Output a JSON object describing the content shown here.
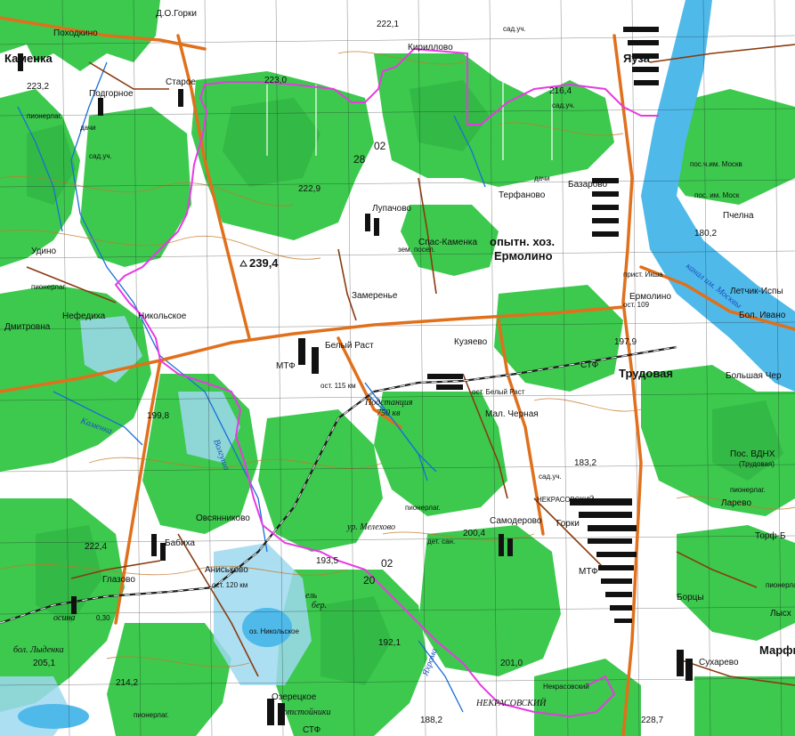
{
  "settlements": [
    {
      "id": "pokhodkino",
      "text": "Походкино"
    },
    {
      "id": "gorki_do",
      "text": "Д.О.Горки"
    },
    {
      "id": "kamenka",
      "text": "Каменка"
    },
    {
      "id": "podgornoe",
      "text": "Подгорное"
    },
    {
      "id": "starovo",
      "text": "Старое"
    },
    {
      "id": "tsirilovo",
      "text": "Кириллово"
    },
    {
      "id": "yauza",
      "text": "Яуза"
    },
    {
      "id": "lupachovo",
      "text": "Лупачово"
    },
    {
      "id": "terfanovo",
      "text": "Терфаново"
    },
    {
      "id": "bazarovo",
      "text": "Базарово"
    },
    {
      "id": "spas_kamenka",
      "text": "Спас-Каменка"
    },
    {
      "id": "opytn_khoz",
      "text": "опытн. хоз."
    },
    {
      "id": "ermolino",
      "text": "Ермолино"
    },
    {
      "id": "ermolino2",
      "text": "Ермолино"
    },
    {
      "id": "udino",
      "text": "Удино"
    },
    {
      "id": "zamerenye",
      "text": "Замеренье"
    },
    {
      "id": "nefediha",
      "text": "Нефедиха"
    },
    {
      "id": "nikolskoe",
      "text": "Никольское"
    },
    {
      "id": "dmitrovna",
      "text": "Дмитровна"
    },
    {
      "id": "belyi_rast",
      "text": "Белый Раст"
    },
    {
      "id": "kuzyaevo",
      "text": "Кузяево"
    },
    {
      "id": "trudovaya",
      "text": "Трудовая"
    },
    {
      "id": "mal_chernaya",
      "text": "Мал. Черная"
    },
    {
      "id": "nekrasovsky",
      "text": "НЕКРАСОВСКИЙ"
    },
    {
      "id": "samoderovo",
      "text": "Самодерово"
    },
    {
      "id": "gorki2",
      "text": "Горки"
    },
    {
      "id": "ovsyannikovo",
      "text": "Овсянниково"
    },
    {
      "id": "babikha",
      "text": "Бабиха"
    },
    {
      "id": "aniskovo",
      "text": "Аниськово"
    },
    {
      "id": "glazovo",
      "text": "Глазово"
    },
    {
      "id": "ozeretskoe",
      "text": "Озерецкое"
    },
    {
      "id": "nekrasovsky2",
      "text": "НЕКРАСОВСКИЙ"
    },
    {
      "id": "nekrasovsky3",
      "text": "Некрасовский"
    },
    {
      "id": "sukharevo",
      "text": "Сухарево"
    },
    {
      "id": "marfino",
      "text": "Марфи"
    },
    {
      "id": "pchelna",
      "text": "Пчелна"
    },
    {
      "id": "bolshaya_chernaya",
      "text": "Большая Чер"
    },
    {
      "id": "letchin",
      "text": "Летчик-Испы"
    },
    {
      "id": "ivanovskoe",
      "text": "Бол. Ивано"
    },
    {
      "id": "larevo",
      "text": "Ларево"
    },
    {
      "id": "torf",
      "text": "Торф-Б"
    },
    {
      "id": "lysk",
      "text": "Лысх"
    },
    {
      "id": "boretsy",
      "text": "Борцы"
    }
  ],
  "labels": {
    "elev_239_4": "239,4",
    "elev_223_0": "223,0",
    "elev_222_9": "222,9",
    "elev_222_1": "222,1",
    "elev_199_8": "199,8",
    "elev_193_5": "193,5",
    "elev_192_1": "192,1",
    "elev_201_0": "201,0",
    "elev_188_2": "188,2",
    "elev_183_2": "183,2",
    "elev_200_4": "200,4",
    "elev_222_4": "222,4",
    "elev_205_1": "205,1",
    "elev_214_2": "214,2",
    "elev_180_2": "180,2",
    "elev_223_2": "223,2",
    "elev_216_4": "216,4",
    "elev_197_9": "197,9",
    "elev_228_7": "228,7",
    "grid_28": "28",
    "grid_02a": "02",
    "grid_20": "20",
    "grid_02b": "02",
    "mtf1": "МТФ",
    "mtf2": "МТФ",
    "stf1": "СТФ",
    "stf2": "СТФ",
    "podstanciya": "Подстанция",
    "podst_kv": "750 кв",
    "ost_belyi_rast": "ост. Белый Раст",
    "ost_115": "ост. 115 км",
    "ost_120": "ост. 120 км",
    "ost_109": "ост. 109",
    "ur_melekhovo": "ур. Мелехово",
    "det_san": "дет. сан.",
    "pionerlag1": "пионерлаг.",
    "pionerlag2": "пионерлаг.",
    "pionerlag3": "пионерлаг.",
    "pionerlag4": "пионерлаг.",
    "pionerlag5": "пионерлаг.",
    "pionerlag6": "пионерлаг.",
    "sad_uch1": "сад.уч.",
    "sad_uch2": "сад.уч.",
    "sad_uch3": "сад.уч.",
    "sad_uch4": "сад.уч.",
    "dachi1": "дачи",
    "dachi2": "дачи",
    "zem_poselok": "зем. посел.",
    "bol_lydenka": "бол. Лыденка",
    "pos_vdnkh": "Пос. ВДНХ",
    "trudovaya_sm": "(Трудовая)",
    "pos_imeni": "пос. им. Моск",
    "pos_chkalov": "пос.ч.им. Москв",
    "prist_ivan": "прист. Икша",
    "kanal": "канал им. Москвы",
    "ostoyniki": "отстойники",
    "nekrasovsky_label": "Некрасовская",
    "nekrasovsky_sm": "НЕКРАСОВСКИЙ",
    "river_kamenka": "Каменка",
    "river_volga": "Волгуша",
    "river_yakhroma": "Яхрома",
    "lake_sm": "оз. Никольское",
    "es_label": "ель",
    "ber_label": "бер.",
    "osina": "осина",
    "ber_30": "0,30"
  },
  "colors": {
    "forest": "#3cc94e",
    "forest_dark": "#2fb241",
    "open": "#ffffff",
    "swamp_blue": "#9ed9f0",
    "water": "#4fb9ea",
    "road_orange": "#e0701c",
    "road_brown": "#8a3a10",
    "rail": "#1c1c1c",
    "contour": "#c4792a",
    "boundary": "#e83ae3",
    "town_black": "#111111",
    "grid_line": "#222222"
  }
}
